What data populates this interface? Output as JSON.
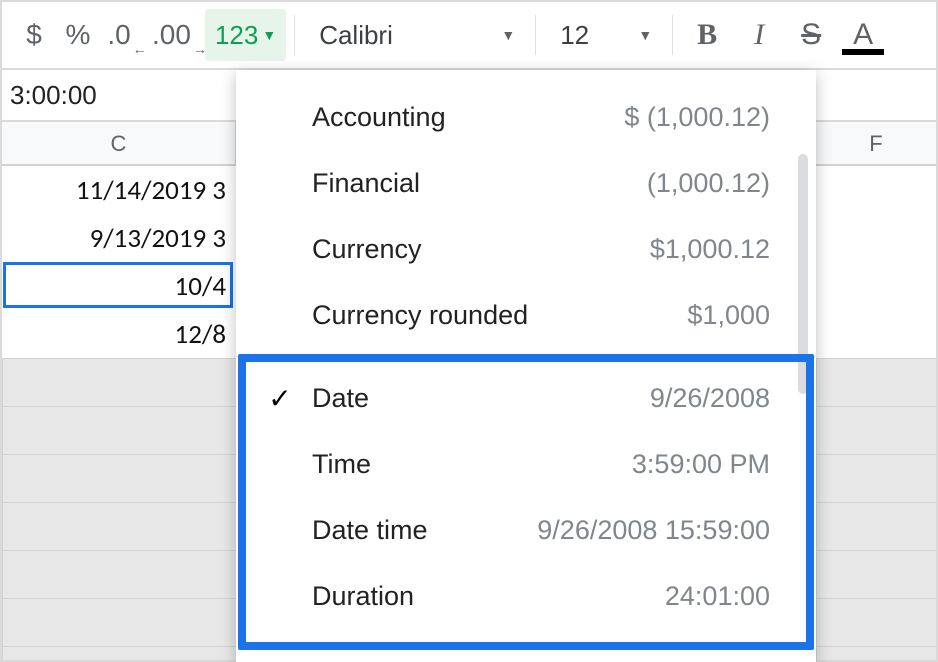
{
  "toolbar": {
    "currency_symbol": "$",
    "percent_symbol": "%",
    "dec_decrease": ".0",
    "dec_increase": ".00",
    "format_trigger": "123",
    "font_name": "Calibri",
    "font_size": "12",
    "bold": "B",
    "italic": "I",
    "strike": "S",
    "text_color": "A"
  },
  "formula_bar": {
    "value": "3:00:00"
  },
  "columns": {
    "C": "C",
    "F": "F"
  },
  "cells": {
    "c_vals": [
      "11/14/2019 3",
      "9/13/2019 3",
      "10/4",
      "12/8"
    ],
    "selected_index": 2
  },
  "format_menu": {
    "section_top": [
      {
        "label": "Accounting",
        "example": "$ (1,000.12)"
      },
      {
        "label": "Financial",
        "example": "(1,000.12)"
      },
      {
        "label": "Currency",
        "example": "$1,000.12"
      },
      {
        "label": "Currency rounded",
        "example": "$1,000"
      }
    ],
    "section_date": [
      {
        "label": "Date",
        "example": "9/26/2008",
        "checked": true
      },
      {
        "label": "Time",
        "example": "3:59:00 PM"
      },
      {
        "label": "Date time",
        "example": "9/26/2008 15:59:00"
      },
      {
        "label": "Duration",
        "example": "24:01:00"
      }
    ]
  }
}
